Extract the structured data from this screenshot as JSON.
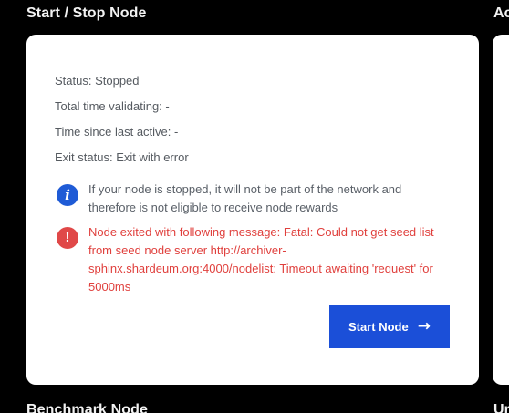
{
  "sections": {
    "start_stop_title": "Start / Stop Node",
    "right_title": "Ac",
    "benchmark_title": "Benchmark Node",
    "right_title_2": "Ur"
  },
  "node_status": {
    "status": "Status: Stopped",
    "total_time": "Total time validating: -",
    "time_since_active": "Time since last active: -",
    "exit_status": "Exit status: Exit with error"
  },
  "notes": {
    "info_icon": "info-icon",
    "info_text": "If your node is stopped, it will not be part of the network and therefore is not eligible to receive node rewards",
    "error_icon": "error-icon",
    "error_text": "Node exited with following message: Fatal: Could not get seed list from seed node server http://archiver-sphinx.shardeum.org:4000/nodelist: Timeout awaiting 'request' for 5000ms"
  },
  "actions": {
    "start_label": "Start Node",
    "start_icon": "arrow-right-icon"
  },
  "colors": {
    "background": "#000000",
    "card": "#ffffff",
    "accent": "#1b4fd8",
    "error": "#e0403d",
    "info": "#1f5bd6"
  }
}
